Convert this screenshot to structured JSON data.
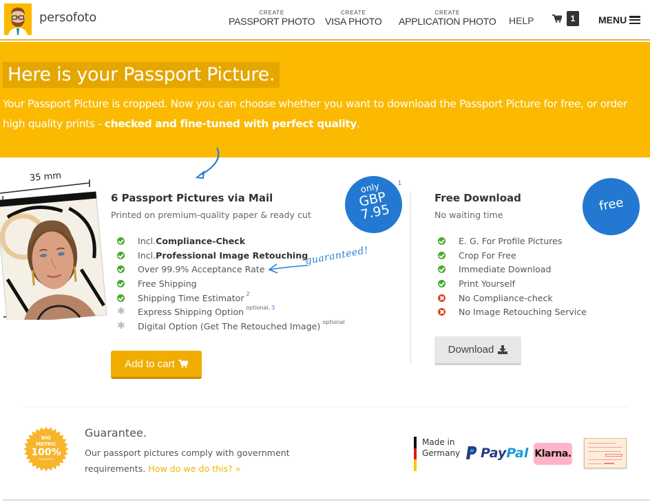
{
  "header": {
    "brand": "persofoto",
    "nav": [
      {
        "small": "CREATE",
        "big": "PASSPORT PHOTO"
      },
      {
        "small": "CREATE",
        "big": "VISA PHOTO"
      },
      {
        "small": "CREATE",
        "big": "APPLICATION PHOTO"
      }
    ],
    "help": "HELP",
    "cart_count": "1",
    "menu": "MENU"
  },
  "hero": {
    "title": "Here is your Passport Picture.",
    "text_plain": "Your Passport Picture is cropped. Now you can choose whether you want to download the Passport Picture for free, or order high quality prints - ",
    "text_bold": "checked and fine-tuned with perfect quality",
    "text_end": "."
  },
  "photo": {
    "dimension_label": "35 mm"
  },
  "offer": {
    "title": "6 Passport Pictures via Mail",
    "subtitle": "Printed on premium-quality paper & ready cut",
    "price_badge": {
      "prefix": "only",
      "currency": "GBP",
      "amount": "7.95",
      "footnote": "1"
    },
    "features": [
      {
        "icon": "check",
        "pre": "Incl. ",
        "bold": "Compliance-Check",
        "text": "",
        "sup": "",
        "sup2": ""
      },
      {
        "icon": "check",
        "pre": "Incl. ",
        "bold": "Professional Image Retouching",
        "text": "",
        "sup": "",
        "sup2": ""
      },
      {
        "icon": "check",
        "pre": "",
        "bold": "",
        "text": "Over 99.9% Acceptance Rate",
        "sup": "",
        "sup2": ""
      },
      {
        "icon": "check",
        "pre": "",
        "bold": "",
        "text": "Free Shipping",
        "sup": "",
        "sup2": ""
      },
      {
        "icon": "check",
        "pre": "",
        "bold": "",
        "text": "Shipping Time Estimator",
        "sup": "",
        "sup2": "2"
      },
      {
        "icon": "asterisk",
        "pre": "",
        "bold": "",
        "text": "Express Shipping Option",
        "sup": "optional,",
        "sup2": "3"
      },
      {
        "icon": "asterisk",
        "pre": "",
        "bold": "",
        "text": "Digital Option (Get The Retouched Image)",
        "sup": "optional",
        "sup2": ""
      }
    ],
    "annotation": "guaranteed!",
    "add_to_cart": "Add to cart"
  },
  "free": {
    "title": "Free Download",
    "subtitle": "No waiting time",
    "badge": "free",
    "features": [
      {
        "icon": "check",
        "text": "E. G. For Profile Pictures"
      },
      {
        "icon": "check",
        "text": "Crop For Free"
      },
      {
        "icon": "check",
        "text": "Immediate Download"
      },
      {
        "icon": "check",
        "text": "Print Yourself"
      },
      {
        "icon": "cross",
        "text": "No Compliance-check"
      },
      {
        "icon": "cross",
        "text": "No Image Retouching Service"
      }
    ],
    "download": "Download"
  },
  "guarantee": {
    "seal": {
      "line1": "BIO",
      "line2": "METRIC",
      "line3": "100%",
      "line4": "GUARANTEE"
    },
    "title": "Guarantee.",
    "text": "Our passport pictures comply with government requirements. ",
    "link": "How do we do this? »"
  },
  "trust": {
    "made_in_line1": "Made in",
    "made_in_line2": "Germany",
    "paypal": {
      "part1": "Pay",
      "part2": "Pal"
    },
    "klarna": "Klarna."
  },
  "colors": {
    "brand_yellow": "#fbb900",
    "badge_blue": "#2379d2",
    "check_green": "#4aa82f",
    "cross_red": "#d24726",
    "link_yellow": "#f2b400"
  }
}
